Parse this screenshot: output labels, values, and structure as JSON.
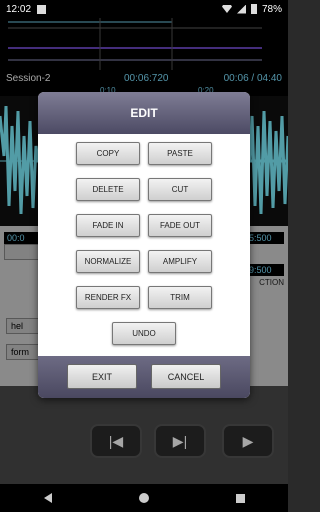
{
  "status_bar": {
    "time": "12:02",
    "battery": "78%"
  },
  "session": {
    "name": "Session-2",
    "time": "00:06:720",
    "position": "00:06 / 04:40"
  },
  "ruler": {
    "ticks": [
      "0:10",
      "0:20"
    ]
  },
  "background_panel": {
    "left_time": "00:0",
    "right_time_1": "5:500",
    "right_time_2": "9:500",
    "right_label": "CTION",
    "left_btn_1": "hel",
    "left_btn_2": "form"
  },
  "dialog": {
    "title": "EDIT",
    "buttons": [
      "COPY",
      "PASTE",
      "DELETE",
      "CUT",
      "FADE IN",
      "FADE OUT",
      "NORMALIZE",
      "AMPLIFY",
      "RENDER FX",
      "TRIM"
    ],
    "undo": "UNDO",
    "exit": "EXIT",
    "cancel": "CANCEL"
  },
  "transport": {
    "prev": "previous-icon",
    "next": "next-icon",
    "play": "play-icon"
  },
  "colors": {
    "accent_time": "#7fe0ff",
    "waveform": "#7ff0ff",
    "dialog_header": "#5f5d78"
  }
}
